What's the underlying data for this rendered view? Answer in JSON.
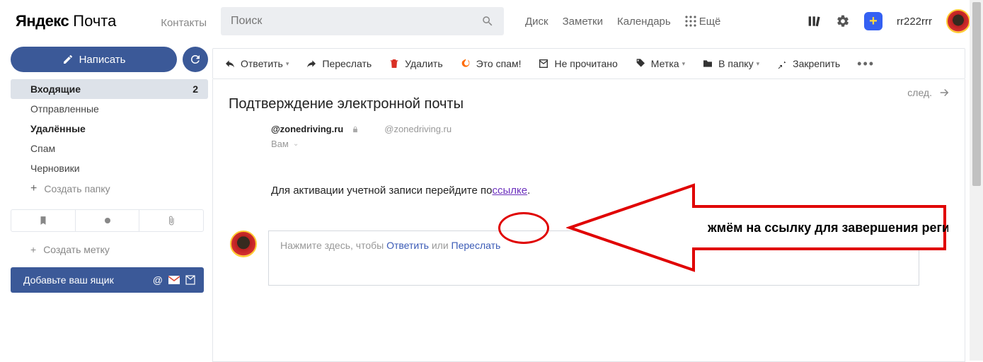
{
  "brand": {
    "yandex": "Яндекс",
    "mail": "Почта"
  },
  "contacts": "Контакты",
  "search": {
    "placeholder": "Поиск"
  },
  "topnav": {
    "disk": "Диск",
    "notes": "Заметки",
    "calendar": "Календарь",
    "more": "Ещё"
  },
  "username": "rr222rrr",
  "compose": "Написать",
  "folders": {
    "inbox": "Входящие",
    "inbox_count": "2",
    "sent": "Отправленные",
    "deleted": "Удалённые",
    "spam": "Спам",
    "drafts": "Черновики",
    "create": "Создать папку"
  },
  "create_label": "Создать метку",
  "add_mailbox": "Добавьте ваш ящик",
  "toolbar": {
    "reply": "Ответить",
    "forward": "Переслать",
    "delete": "Удалить",
    "spam": "Это спам!",
    "unread": "Не прочитано",
    "label": "Метка",
    "folder": "В папку",
    "pin": "Закрепить"
  },
  "nav_next": "след.",
  "message": {
    "subject": "Подтверждение электронной почты",
    "from_domain": "@zonedriving.ru",
    "from_email": "@zonedriving.ru",
    "to": "Вам",
    "body_prefix": "Для активации учетной записи перейдите по ",
    "body_link": "ссылке",
    "body_suffix": "."
  },
  "reply_box": {
    "prefix": "Нажмите здесь, чтобы ",
    "reply": "Ответить",
    "or": " или ",
    "forward": "Переслать"
  },
  "annotation_text": "жмём на ссылку для завершения регистрации !"
}
